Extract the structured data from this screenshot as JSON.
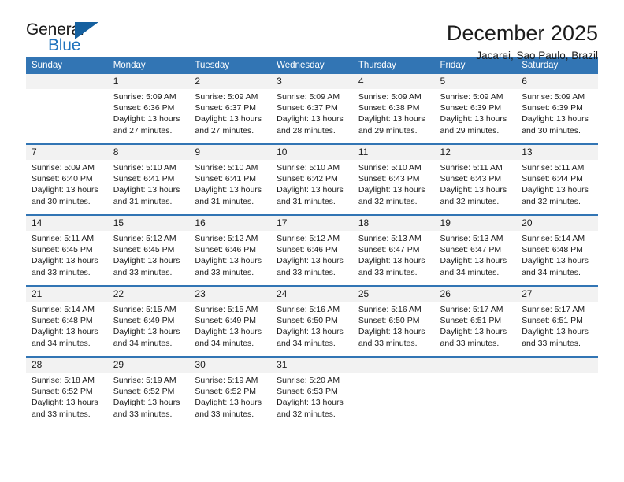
{
  "logo": {
    "word_one": "General",
    "word_two": "Blue",
    "triangle_icon": "triangle-right-icon",
    "blue": "#1f72bd",
    "triangle_color": "#15609f"
  },
  "header": {
    "title": "December 2025",
    "subtitle": "Jacarei, Sao Paulo, Brazil"
  },
  "theme": {
    "header_blue": "#3275b4",
    "daynum_band": "#f2f2f2",
    "text": "#1c1c1c"
  },
  "weekdays": [
    "Sunday",
    "Monday",
    "Tuesday",
    "Wednesday",
    "Thursday",
    "Friday",
    "Saturday"
  ],
  "weeks": [
    [
      {
        "day": "",
        "blank": true,
        "sunrise": "",
        "sunset": "",
        "daylight1": "",
        "daylight2": ""
      },
      {
        "day": "1",
        "sunrise": "Sunrise: 5:09 AM",
        "sunset": "Sunset: 6:36 PM",
        "daylight1": "Daylight: 13 hours",
        "daylight2": "and 27 minutes."
      },
      {
        "day": "2",
        "sunrise": "Sunrise: 5:09 AM",
        "sunset": "Sunset: 6:37 PM",
        "daylight1": "Daylight: 13 hours",
        "daylight2": "and 27 minutes."
      },
      {
        "day": "3",
        "sunrise": "Sunrise: 5:09 AM",
        "sunset": "Sunset: 6:37 PM",
        "daylight1": "Daylight: 13 hours",
        "daylight2": "and 28 minutes."
      },
      {
        "day": "4",
        "sunrise": "Sunrise: 5:09 AM",
        "sunset": "Sunset: 6:38 PM",
        "daylight1": "Daylight: 13 hours",
        "daylight2": "and 29 minutes."
      },
      {
        "day": "5",
        "sunrise": "Sunrise: 5:09 AM",
        "sunset": "Sunset: 6:39 PM",
        "daylight1": "Daylight: 13 hours",
        "daylight2": "and 29 minutes."
      },
      {
        "day": "6",
        "sunrise": "Sunrise: 5:09 AM",
        "sunset": "Sunset: 6:39 PM",
        "daylight1": "Daylight: 13 hours",
        "daylight2": "and 30 minutes."
      }
    ],
    [
      {
        "day": "7",
        "sunrise": "Sunrise: 5:09 AM",
        "sunset": "Sunset: 6:40 PM",
        "daylight1": "Daylight: 13 hours",
        "daylight2": "and 30 minutes."
      },
      {
        "day": "8",
        "sunrise": "Sunrise: 5:10 AM",
        "sunset": "Sunset: 6:41 PM",
        "daylight1": "Daylight: 13 hours",
        "daylight2": "and 31 minutes."
      },
      {
        "day": "9",
        "sunrise": "Sunrise: 5:10 AM",
        "sunset": "Sunset: 6:41 PM",
        "daylight1": "Daylight: 13 hours",
        "daylight2": "and 31 minutes."
      },
      {
        "day": "10",
        "sunrise": "Sunrise: 5:10 AM",
        "sunset": "Sunset: 6:42 PM",
        "daylight1": "Daylight: 13 hours",
        "daylight2": "and 31 minutes."
      },
      {
        "day": "11",
        "sunrise": "Sunrise: 5:10 AM",
        "sunset": "Sunset: 6:43 PM",
        "daylight1": "Daylight: 13 hours",
        "daylight2": "and 32 minutes."
      },
      {
        "day": "12",
        "sunrise": "Sunrise: 5:11 AM",
        "sunset": "Sunset: 6:43 PM",
        "daylight1": "Daylight: 13 hours",
        "daylight2": "and 32 minutes."
      },
      {
        "day": "13",
        "sunrise": "Sunrise: 5:11 AM",
        "sunset": "Sunset: 6:44 PM",
        "daylight1": "Daylight: 13 hours",
        "daylight2": "and 32 minutes."
      }
    ],
    [
      {
        "day": "14",
        "sunrise": "Sunrise: 5:11 AM",
        "sunset": "Sunset: 6:45 PM",
        "daylight1": "Daylight: 13 hours",
        "daylight2": "and 33 minutes."
      },
      {
        "day": "15",
        "sunrise": "Sunrise: 5:12 AM",
        "sunset": "Sunset: 6:45 PM",
        "daylight1": "Daylight: 13 hours",
        "daylight2": "and 33 minutes."
      },
      {
        "day": "16",
        "sunrise": "Sunrise: 5:12 AM",
        "sunset": "Sunset: 6:46 PM",
        "daylight1": "Daylight: 13 hours",
        "daylight2": "and 33 minutes."
      },
      {
        "day": "17",
        "sunrise": "Sunrise: 5:12 AM",
        "sunset": "Sunset: 6:46 PM",
        "daylight1": "Daylight: 13 hours",
        "daylight2": "and 33 minutes."
      },
      {
        "day": "18",
        "sunrise": "Sunrise: 5:13 AM",
        "sunset": "Sunset: 6:47 PM",
        "daylight1": "Daylight: 13 hours",
        "daylight2": "and 33 minutes."
      },
      {
        "day": "19",
        "sunrise": "Sunrise: 5:13 AM",
        "sunset": "Sunset: 6:47 PM",
        "daylight1": "Daylight: 13 hours",
        "daylight2": "and 34 minutes."
      },
      {
        "day": "20",
        "sunrise": "Sunrise: 5:14 AM",
        "sunset": "Sunset: 6:48 PM",
        "daylight1": "Daylight: 13 hours",
        "daylight2": "and 34 minutes."
      }
    ],
    [
      {
        "day": "21",
        "sunrise": "Sunrise: 5:14 AM",
        "sunset": "Sunset: 6:48 PM",
        "daylight1": "Daylight: 13 hours",
        "daylight2": "and 34 minutes."
      },
      {
        "day": "22",
        "sunrise": "Sunrise: 5:15 AM",
        "sunset": "Sunset: 6:49 PM",
        "daylight1": "Daylight: 13 hours",
        "daylight2": "and 34 minutes."
      },
      {
        "day": "23",
        "sunrise": "Sunrise: 5:15 AM",
        "sunset": "Sunset: 6:49 PM",
        "daylight1": "Daylight: 13 hours",
        "daylight2": "and 34 minutes."
      },
      {
        "day": "24",
        "sunrise": "Sunrise: 5:16 AM",
        "sunset": "Sunset: 6:50 PM",
        "daylight1": "Daylight: 13 hours",
        "daylight2": "and 34 minutes."
      },
      {
        "day": "25",
        "sunrise": "Sunrise: 5:16 AM",
        "sunset": "Sunset: 6:50 PM",
        "daylight1": "Daylight: 13 hours",
        "daylight2": "and 33 minutes."
      },
      {
        "day": "26",
        "sunrise": "Sunrise: 5:17 AM",
        "sunset": "Sunset: 6:51 PM",
        "daylight1": "Daylight: 13 hours",
        "daylight2": "and 33 minutes."
      },
      {
        "day": "27",
        "sunrise": "Sunrise: 5:17 AM",
        "sunset": "Sunset: 6:51 PM",
        "daylight1": "Daylight: 13 hours",
        "daylight2": "and 33 minutes."
      }
    ],
    [
      {
        "day": "28",
        "sunrise": "Sunrise: 5:18 AM",
        "sunset": "Sunset: 6:52 PM",
        "daylight1": "Daylight: 13 hours",
        "daylight2": "and 33 minutes."
      },
      {
        "day": "29",
        "sunrise": "Sunrise: 5:19 AM",
        "sunset": "Sunset: 6:52 PM",
        "daylight1": "Daylight: 13 hours",
        "daylight2": "and 33 minutes."
      },
      {
        "day": "30",
        "sunrise": "Sunrise: 5:19 AM",
        "sunset": "Sunset: 6:52 PM",
        "daylight1": "Daylight: 13 hours",
        "daylight2": "and 33 minutes."
      },
      {
        "day": "31",
        "sunrise": "Sunrise: 5:20 AM",
        "sunset": "Sunset: 6:53 PM",
        "daylight1": "Daylight: 13 hours",
        "daylight2": "and 32 minutes."
      },
      {
        "day": "",
        "blank": true,
        "sunrise": "",
        "sunset": "",
        "daylight1": "",
        "daylight2": ""
      },
      {
        "day": "",
        "blank": true,
        "sunrise": "",
        "sunset": "",
        "daylight1": "",
        "daylight2": ""
      },
      {
        "day": "",
        "blank": true,
        "sunrise": "",
        "sunset": "",
        "daylight1": "",
        "daylight2": ""
      }
    ]
  ]
}
